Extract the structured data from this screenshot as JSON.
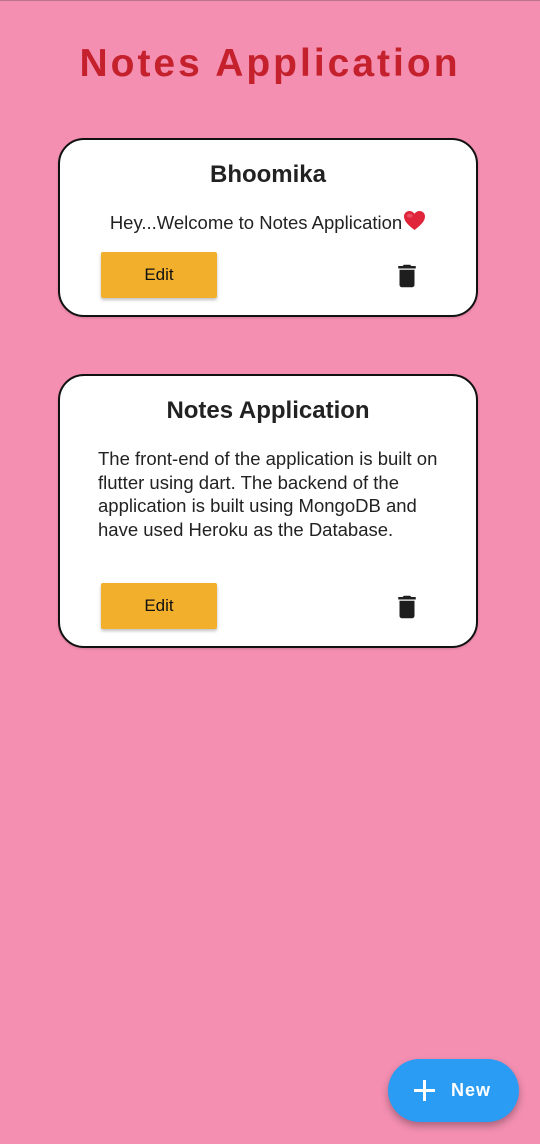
{
  "app": {
    "title": "Notes Application"
  },
  "notes": [
    {
      "title": "Bhoomika",
      "body": "Hey...Welcome to Notes Application",
      "emoji_icon": "heart-emoji-icon",
      "edit_label": "Edit",
      "delete_icon": "trash-icon"
    },
    {
      "title": "Notes Application",
      "body": "The front-end of the application is built on flutter using dart. The backend of the application is built using MongoDB and have used Heroku as the Database.",
      "edit_label": "Edit",
      "delete_icon": "trash-icon"
    }
  ],
  "fab": {
    "label": "New",
    "icon": "plus-icon"
  },
  "colors": {
    "background": "#f48fb1",
    "title": "#c4212c",
    "edit_button": "#f2af2c",
    "fab": "#2a9cf3"
  }
}
